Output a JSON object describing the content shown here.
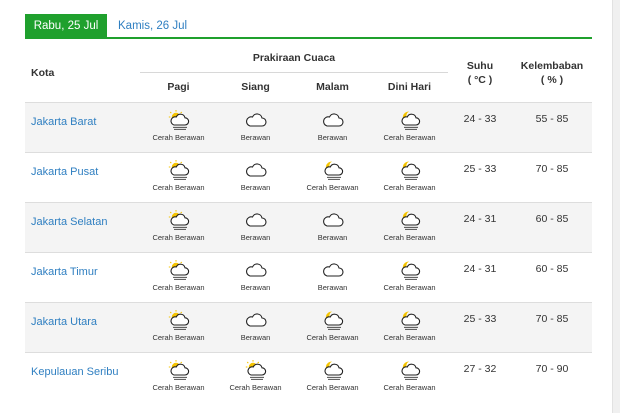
{
  "tabs": [
    {
      "label": "Rabu, 25 Jul",
      "active": true
    },
    {
      "label": "Kamis, 26 Jul",
      "active": false
    }
  ],
  "header": {
    "kota": "Kota",
    "prakiraan": "Prakiraan Cuaca",
    "periods": [
      "Pagi",
      "Siang",
      "Malam",
      "Dini Hari"
    ],
    "suhu_line1": "Suhu",
    "suhu_line2": "( °C )",
    "kelembaban_line1": "Kelembaban",
    "kelembaban_line2": "( % )"
  },
  "rows": [
    {
      "city": "Jakarta Barat",
      "weather": [
        {
          "label": "Cerah Berawan",
          "icon": "partly-cloudy-day-icon"
        },
        {
          "label": "Berawan",
          "icon": "cloud-icon"
        },
        {
          "label": "Berawan",
          "icon": "cloud-icon"
        },
        {
          "label": "Cerah Berawan",
          "icon": "partly-cloudy-night-icon"
        }
      ],
      "suhu": "24 - 33",
      "kelembaban": "55 - 85"
    },
    {
      "city": "Jakarta Pusat",
      "weather": [
        {
          "label": "Cerah Berawan",
          "icon": "partly-cloudy-day-icon"
        },
        {
          "label": "Berawan",
          "icon": "cloud-icon"
        },
        {
          "label": "Cerah Berawan",
          "icon": "partly-cloudy-night-icon"
        },
        {
          "label": "Cerah Berawan",
          "icon": "partly-cloudy-night-icon"
        }
      ],
      "suhu": "25 - 33",
      "kelembaban": "70 - 85"
    },
    {
      "city": "Jakarta Selatan",
      "weather": [
        {
          "label": "Cerah Berawan",
          "icon": "partly-cloudy-day-icon"
        },
        {
          "label": "Berawan",
          "icon": "cloud-icon"
        },
        {
          "label": "Berawan",
          "icon": "cloud-icon"
        },
        {
          "label": "Cerah Berawan",
          "icon": "partly-cloudy-night-icon"
        }
      ],
      "suhu": "24 - 31",
      "kelembaban": "60 - 85"
    },
    {
      "city": "Jakarta Timur",
      "weather": [
        {
          "label": "Cerah Berawan",
          "icon": "partly-cloudy-day-icon"
        },
        {
          "label": "Berawan",
          "icon": "cloud-icon"
        },
        {
          "label": "Berawan",
          "icon": "cloud-icon"
        },
        {
          "label": "Cerah Berawan",
          "icon": "partly-cloudy-night-icon"
        }
      ],
      "suhu": "24 - 31",
      "kelembaban": "60 - 85"
    },
    {
      "city": "Jakarta Utara",
      "weather": [
        {
          "label": "Cerah Berawan",
          "icon": "partly-cloudy-day-icon"
        },
        {
          "label": "Berawan",
          "icon": "cloud-icon"
        },
        {
          "label": "Cerah Berawan",
          "icon": "partly-cloudy-night-icon"
        },
        {
          "label": "Cerah Berawan",
          "icon": "partly-cloudy-night-icon"
        }
      ],
      "suhu": "25 - 33",
      "kelembaban": "70 - 85"
    },
    {
      "city": "Kepulauan Seribu",
      "weather": [
        {
          "label": "Cerah Berawan",
          "icon": "partly-cloudy-day-icon"
        },
        {
          "label": "Cerah Berawan",
          "icon": "partly-cloudy-day-icon"
        },
        {
          "label": "Cerah Berawan",
          "icon": "partly-cloudy-night-icon"
        },
        {
          "label": "Cerah Berawan",
          "icon": "partly-cloudy-night-icon"
        }
      ],
      "suhu": "27 - 32",
      "kelembaban": "70 - 90"
    }
  ],
  "colors": {
    "tab_active": "#1fa02d",
    "link": "#2f7fc1",
    "sun": "#f5c400",
    "moon": "#f5c400"
  }
}
